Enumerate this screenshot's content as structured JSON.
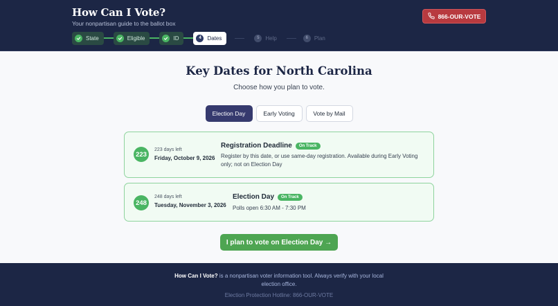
{
  "header": {
    "title": "How Can I Vote?",
    "subtitle": "Your nonpartisan guide to the ballot box",
    "hotline_label": "866-OUR-VOTE",
    "steps": [
      {
        "label": "State",
        "status": "done",
        "marker": "check"
      },
      {
        "label": "Eligible",
        "status": "done",
        "marker": "check"
      },
      {
        "label": "ID",
        "status": "done",
        "marker": "check"
      },
      {
        "label": "Dates",
        "status": "current",
        "marker": "4"
      },
      {
        "label": "Help",
        "status": "todo",
        "marker": "5"
      },
      {
        "label": "Plan",
        "status": "todo",
        "marker": "6"
      }
    ]
  },
  "main": {
    "title": "Key Dates for North Carolina",
    "subtitle": "Choose how you plan to vote.",
    "tabs": [
      {
        "label": "Election Day",
        "active": true
      },
      {
        "label": "Early Voting",
        "active": false
      },
      {
        "label": "Vote by Mail",
        "active": false
      }
    ],
    "cards": [
      {
        "count": "223",
        "days_left": "223 days left",
        "date": "Friday, October 9, 2026",
        "title": "Registration Deadline",
        "badge": "On Track",
        "description": "Register by this date, or use same-day registration. Available during Early Voting only; not on Election Day"
      },
      {
        "count": "248",
        "days_left": "248 days left",
        "date": "Tuesday, November 3, 2026",
        "title": "Election Day",
        "badge": "On Track",
        "description": "Polls open 6:30 AM - 7:30 PM"
      }
    ],
    "cta_label": "I plan to vote on Election Day →"
  },
  "footer": {
    "brand": "How Can I Vote?",
    "text_1": " is a nonpartisan voter information tool. Always verify with your local",
    "text_2": "election office.",
    "hotline": "Election Protection Hotline: 866-OUR-VOTE"
  },
  "colors": {
    "navy": "#1c2645",
    "green": "#4ab563",
    "red": "#b83a3f",
    "purple": "#363a6e"
  }
}
